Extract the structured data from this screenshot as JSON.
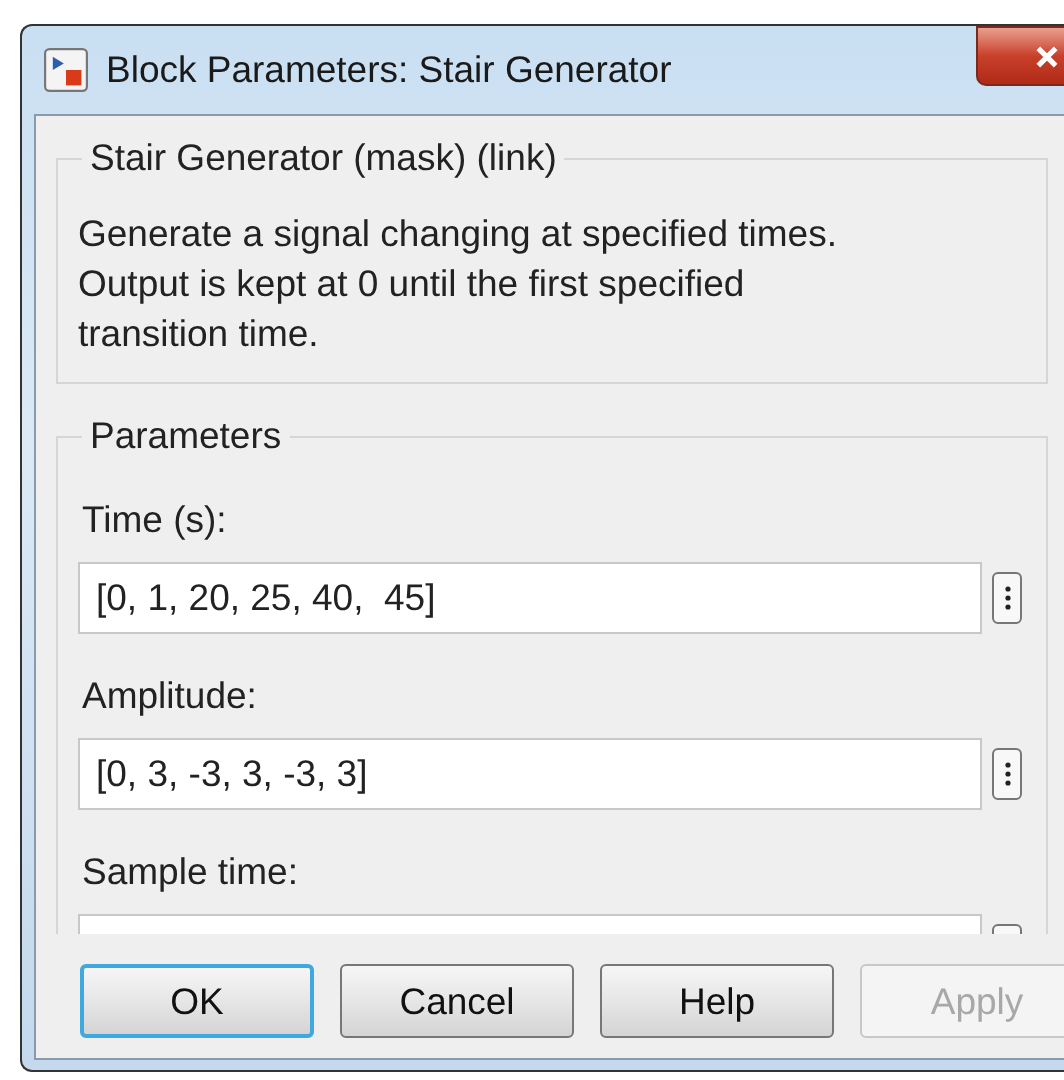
{
  "window": {
    "title": "Block Parameters: Stair Generator"
  },
  "description_group": {
    "title": "Stair Generator (mask) (link)",
    "text": "Generate a signal changing at specified times.\nOutput is kept at 0 until the first specified\ntransition time."
  },
  "parameters": {
    "title": "Parameters",
    "fields": [
      {
        "label": "Time (s):",
        "value": "[0, 1, 20, 25, 40,  45]"
      },
      {
        "label": "Amplitude:",
        "value": "[0, 3, -3, 3, -3, 3]"
      },
      {
        "label": "Sample time:"
      }
    ]
  },
  "buttons": [
    {
      "label": "OK",
      "default": true,
      "disabled": false
    },
    {
      "label": "Cancel",
      "default": false,
      "disabled": false
    },
    {
      "label": "Help",
      "default": false,
      "disabled": false
    },
    {
      "label": "Apply",
      "default": false,
      "disabled": true
    }
  ]
}
